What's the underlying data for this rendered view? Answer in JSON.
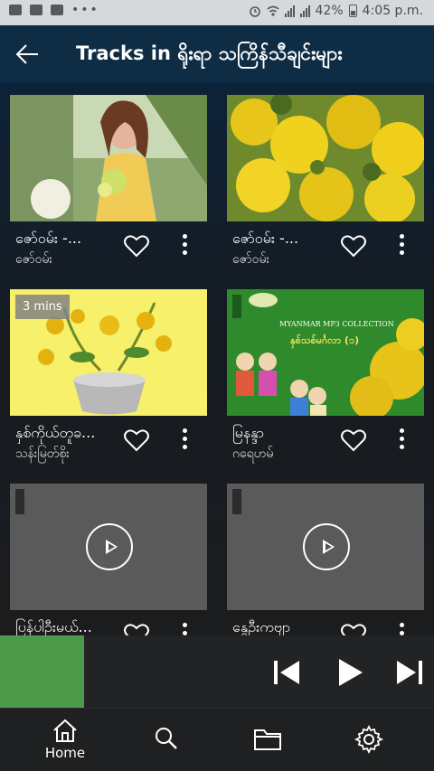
{
  "status_bar": {
    "battery": "42%",
    "time": "4:05 p.m."
  },
  "header": {
    "title": "Tracks in ရိုးရာ သကြိန်သီချင်းများ"
  },
  "tracks": [
    {
      "title": "ဇော်ဝမ်း -...",
      "artist": "ဇော်ဝမ်း",
      "duration": ""
    },
    {
      "title": "ဇော်ဝမ်း -...",
      "artist": "ဇော်ဝမ်း",
      "duration": ""
    },
    {
      "title": "နှစ်ကိုယ်တူခ...",
      "artist": "သန်းမြတ်စိုး",
      "duration": "3 mins"
    },
    {
      "title": "မြနန္ဒာ",
      "artist": "ဂရေဟမ်",
      "duration": ""
    },
    {
      "title": "ပြန်ပါဦးမယ်...",
      "artist": "",
      "duration": ""
    },
    {
      "title": "နွေဦးကဗျာ",
      "artist": "",
      "duration": ""
    }
  ],
  "thumb4": {
    "line1": "MYANMAR MP3 COLLECTION",
    "line2": "နှစ်သစ်မင်္ဂလာ (၁)"
  },
  "nav": {
    "home_label": "Home"
  },
  "colors": {
    "header": "#0e2d45",
    "player_art": "#4e9a4a",
    "background": "#1b1c1e"
  }
}
